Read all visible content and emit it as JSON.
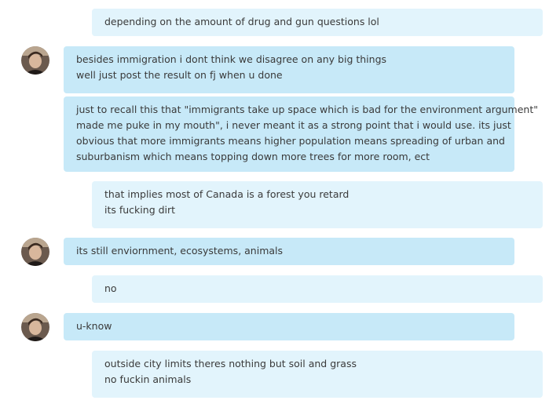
{
  "messages": [
    {
      "sender": "me",
      "lines": [
        "depending on the amount of drug and gun questions lol"
      ]
    },
    {
      "sender": "other",
      "avatar": true,
      "lines": [
        "besides immigration i dont think we disagree on any big things",
        "well just post the result on fj when u done"
      ]
    },
    {
      "sender": "other",
      "lines": [
        "just to recall this that \"immigrants take up space which is bad for the environment argument\"",
        "made me puke in my mouth\", i never meant it as a strong point that i would use. its just",
        "obvious that more immigrants means higher population means spreading of urban and",
        "suburbanism which means topping down more trees for more room, ect"
      ]
    },
    {
      "sender": "me",
      "lines": [
        "that implies most of Canada is a forest you retard",
        "its fucking dirt"
      ]
    },
    {
      "sender": "other",
      "avatar": true,
      "lines": [
        "its still enviornment, ecosystems, animals"
      ]
    },
    {
      "sender": "me",
      "lines": [
        "no"
      ]
    },
    {
      "sender": "other",
      "avatar": true,
      "lines": [
        "u-know"
      ]
    },
    {
      "sender": "me",
      "lines": [
        "outside city limits theres nothing but soil and grass",
        "no fuckin animals"
      ]
    }
  ],
  "colors": {
    "other_bubble": "#c7e9f8",
    "my_bubble": "#e2f4fc",
    "text": "#3a3a3a"
  },
  "icons": {
    "avatar": "contact-avatar"
  }
}
